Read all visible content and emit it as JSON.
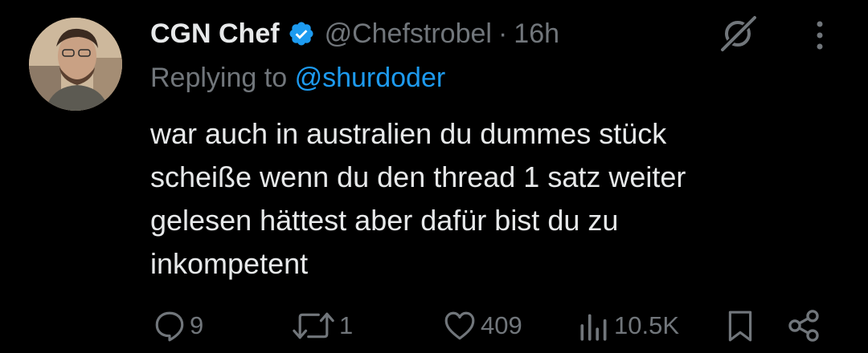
{
  "author": {
    "display_name": "CGN Chef",
    "handle": "@Chefstrobel",
    "separator": "·",
    "time": "16h",
    "verified": true
  },
  "reply": {
    "prefix": "Replying to",
    "mention": "@shurdoder"
  },
  "body": {
    "lines": [
      "war auch in australien du dummes stück",
      "scheiße wenn du den thread 1 satz weiter",
      "gelesen hättest aber dafür bist du zu",
      "inkompetent"
    ]
  },
  "actions": {
    "replies": "9",
    "reposts": "1",
    "likes": "409",
    "views": "10.5K"
  },
  "icons": {
    "verified": "verified-badge-icon",
    "grok": "grok-slash-icon",
    "more": "more-vertical-icon",
    "reply": "reply-bubble-icon",
    "repost": "repost-icon",
    "like": "heart-icon",
    "views": "analytics-bars-icon",
    "bookmark": "bookmark-icon",
    "share": "share-icon"
  },
  "colors": {
    "background": "#000000",
    "text": "#e7e9ea",
    "muted": "#71767b",
    "accent": "#1d9bf0"
  }
}
